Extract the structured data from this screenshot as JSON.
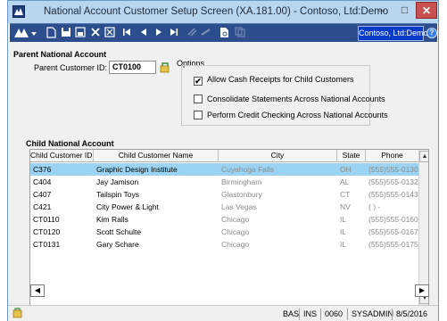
{
  "window": {
    "title": "National Account Customer Setup Screen (XA.181.00) - Contoso, Ltd:Demo",
    "minimize": "–",
    "maximize": "□",
    "close": "✕"
  },
  "toolbar": {
    "company": "Contoso, Ltd:Demo",
    "help": "?"
  },
  "parent": {
    "section_title": "Parent National Account",
    "customer_id_label": "Parent Customer ID:",
    "customer_id_value": "CT0100"
  },
  "options": {
    "title": "Options",
    "items": [
      {
        "label": "Allow Cash Receipts for Child Customers",
        "checked": true
      },
      {
        "label": "Consolidate Statements Across National Accounts",
        "checked": false
      },
      {
        "label": "Perform Credit Checking Across National Accounts",
        "checked": false
      }
    ]
  },
  "child": {
    "section_title": "Child National Account",
    "columns": [
      "Child Customer ID *",
      "Child Customer Name",
      "City",
      "State",
      "Phone"
    ],
    "rows": [
      {
        "id": "C376",
        "name": "Graphic Design Institute",
        "city": "Cuyahoga Falls",
        "state": "OH",
        "phone": "(555)555-0130"
      },
      {
        "id": "C404",
        "name": "Jay Jamison",
        "city": "Birmingham",
        "state": "AL",
        "phone": "(555)555-0132"
      },
      {
        "id": "C407",
        "name": "Tailspin Toys",
        "city": "Glastonbury",
        "state": "CT",
        "phone": "(555)555-0143"
      },
      {
        "id": "C421",
        "name": "City Power & Light",
        "city": "Las Vegas",
        "state": "NV",
        "phone": "(  )  -"
      },
      {
        "id": "CT0110",
        "name": "Kim Ralls",
        "city": "Chicago",
        "state": "IL",
        "phone": "(555)555-0160"
      },
      {
        "id": "CT0120",
        "name": "Scott Schulte",
        "city": "Chicago",
        "state": "IL",
        "phone": "(555)555-0167"
      },
      {
        "id": "CT0131",
        "name": "Gary Schare",
        "city": "Chicago",
        "state": "IL",
        "phone": "(555)555-0175"
      }
    ]
  },
  "status": {
    "mode": "BAS",
    "ins": "INS",
    "code": "0060",
    "user": "SYSADMIN",
    "date": "8/5/2016"
  }
}
